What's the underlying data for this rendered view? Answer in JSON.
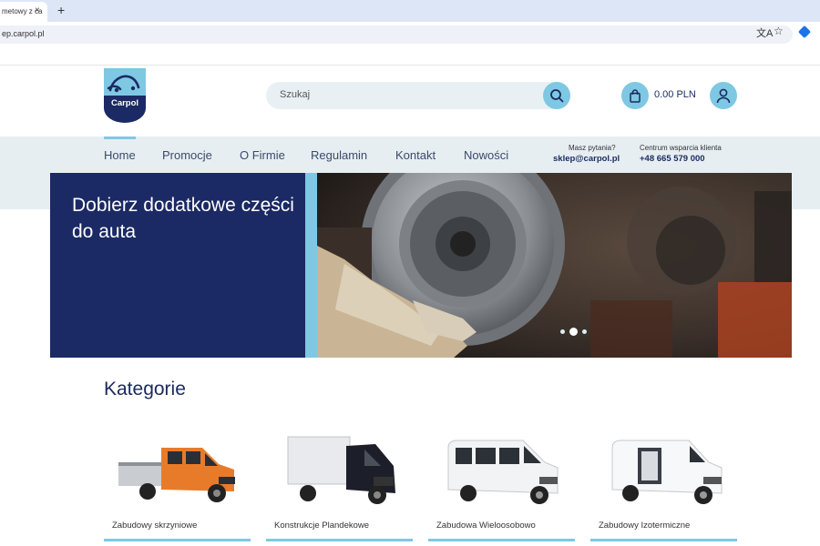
{
  "browser": {
    "tab_title": "metowy z ca",
    "close_glyph": "×",
    "new_tab_glyph": "+",
    "url": "ep.carpol.pl",
    "translate_glyph": "文A",
    "star_glyph": "☆"
  },
  "header": {
    "logo_text": "Carpol",
    "search_placeholder": "Szukaj",
    "cart_total": "0.00 PLN"
  },
  "nav": {
    "items": [
      {
        "label": "Home"
      },
      {
        "label": "Promocje"
      },
      {
        "label": "O Firmie"
      },
      {
        "label": "Regulamin"
      },
      {
        "label": "Kontakt"
      },
      {
        "label": "Nowości"
      }
    ],
    "contact_question": "Masz pytania?",
    "contact_email": "sklep@carpol.pl",
    "support_label": "Centrum wsparcia klienta",
    "support_phone": "+48 665 579 000"
  },
  "hero": {
    "title": "Dobierz dodatkowe części do auta",
    "slides_total": 3,
    "active_slide": 2
  },
  "categories": {
    "heading": "Kategorie",
    "items": [
      {
        "label": "Zabudowy skrzyniowe"
      },
      {
        "label": "Konstrukcje Plandekowe"
      },
      {
        "label": "Zabudowa Wieloosobowo"
      },
      {
        "label": "Zabudowy Izotermiczne"
      }
    ]
  },
  "colors": {
    "navy": "#1b2a64",
    "accent": "#7ec8e3",
    "band": "#e6eef2"
  }
}
